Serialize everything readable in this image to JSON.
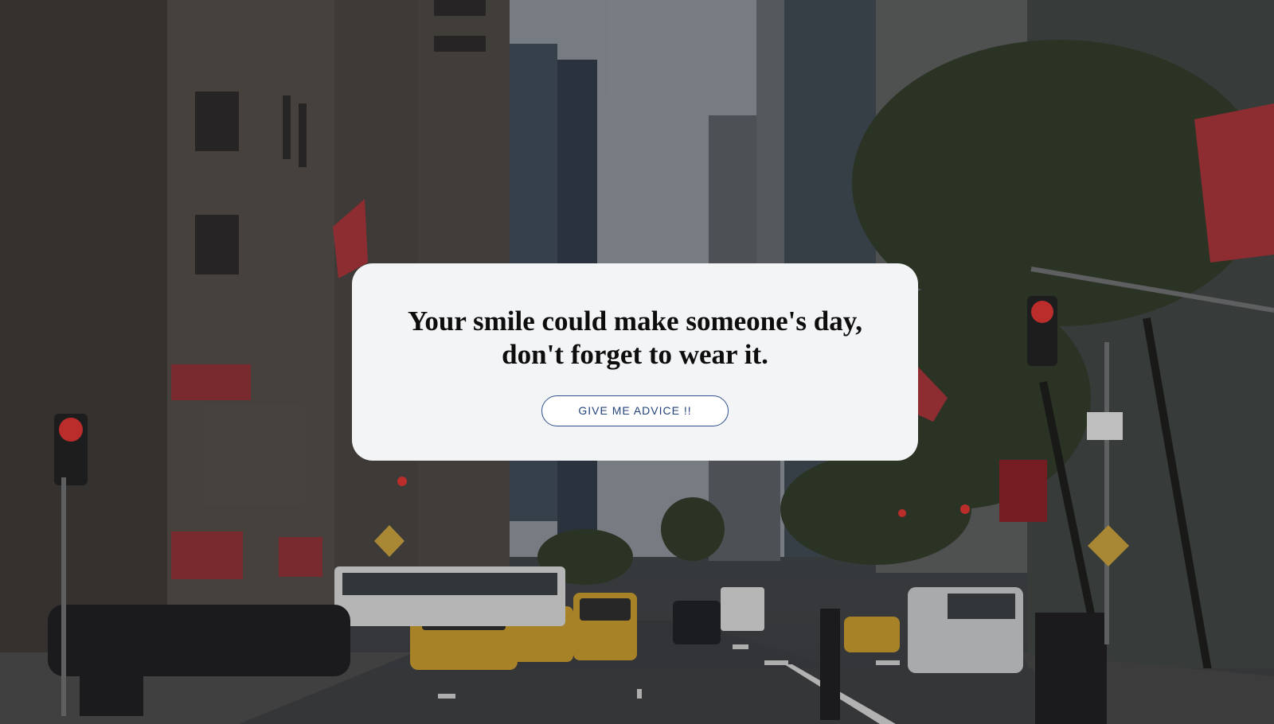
{
  "quote": {
    "line1": "Your smile could make someone's day,",
    "line2": "don't forget to wear it."
  },
  "button": {
    "label": "GIVE ME ADVICE !!"
  },
  "colors": {
    "card_background": "#f3f4f6",
    "button_border": "#2f4f8f",
    "button_text": "#23437a",
    "quote_text": "#0d0d0d"
  },
  "background": {
    "description_icon": "city-street-photo"
  }
}
